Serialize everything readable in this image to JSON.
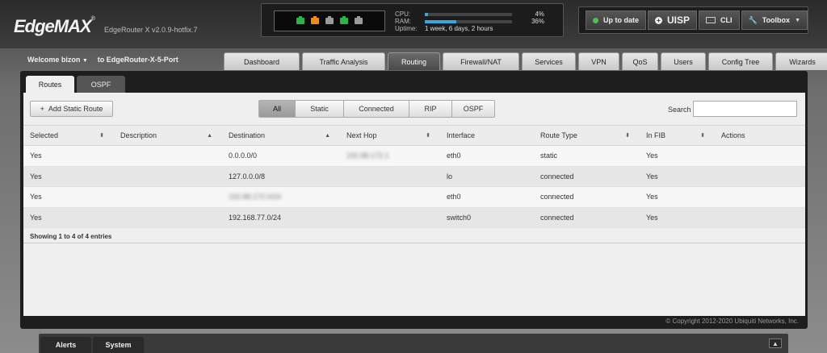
{
  "header": {
    "logo": "EdgeMAX",
    "logo_mark": "®",
    "model": "EdgeRouter X v2.0.9-hotfix.7",
    "ports": [
      {
        "color": "#2eb24a"
      },
      {
        "color": "#f08a1c"
      },
      {
        "color": "#9a9a9a"
      },
      {
        "color": "#2eb24a"
      },
      {
        "color": "#9a9a9a"
      }
    ],
    "cpu_label": "CPU:",
    "cpu_value": "4%",
    "cpu_percent": 4,
    "ram_label": "RAM:",
    "ram_value": "36%",
    "ram_percent": 36,
    "uptime_label": "Uptime:",
    "uptime_value": "1 week, 6 days, 2 hours",
    "update_status": "Up to date",
    "uisp_label": "UISP",
    "cli_label": "CLI",
    "toolbox_label": "Toolbox"
  },
  "welcome": {
    "user": "Welcome bizon",
    "device": "to EdgeRouter-X-5-Port"
  },
  "main_tabs": [
    {
      "label": "Dashboard",
      "w": 0
    },
    {
      "label": "Traffic Analysis"
    },
    {
      "label": "Routing",
      "active": true
    },
    {
      "label": "Firewall/NAT"
    },
    {
      "label": "Services"
    },
    {
      "label": "VPN"
    },
    {
      "label": "QoS"
    },
    {
      "label": "Users"
    },
    {
      "label": "Config Tree"
    },
    {
      "label": "Wizards"
    }
  ],
  "sub_tabs": [
    {
      "label": "Routes",
      "active": true
    },
    {
      "label": "OSPF"
    }
  ],
  "toolbar": {
    "add_route_label": "Add Static Route",
    "filters": [
      {
        "label": "All",
        "active": true
      },
      {
        "label": "Static"
      },
      {
        "label": "Connected"
      },
      {
        "label": "RIP"
      },
      {
        "label": "OSPF"
      }
    ],
    "search_label": "Search",
    "search_value": ""
  },
  "table": {
    "columns": [
      "Selected",
      "Description",
      "Destination",
      "Next Hop",
      "Interface",
      "Route Type",
      "In FIB",
      "Actions"
    ],
    "rows": [
      {
        "selected": "Yes",
        "description": "",
        "destination": "0.0.0.0/0",
        "next_hop": "192.88.172.1",
        "interface": "eth0",
        "route_type": "static",
        "in_fib": "Yes",
        "actions": ""
      },
      {
        "selected": "Yes",
        "description": "",
        "destination": "127.0.0.0/8",
        "next_hop": "",
        "interface": "lo",
        "route_type": "connected",
        "in_fib": "Yes",
        "actions": ""
      },
      {
        "selected": "Yes",
        "description": "",
        "destination": "192.88.172.0/24",
        "next_hop": "",
        "interface": "eth0",
        "route_type": "connected",
        "in_fib": "Yes",
        "actions": ""
      },
      {
        "selected": "Yes",
        "description": "",
        "destination": "192.168.77.0/24",
        "next_hop": "",
        "interface": "switch0",
        "route_type": "connected",
        "in_fib": "Yes",
        "actions": ""
      }
    ],
    "summary": "Showing 1 to 4 of 4 entries"
  },
  "copyright": "© Copyright 2012-2020 Ubiquiti Networks, Inc.",
  "bottom": {
    "alerts_label": "Alerts",
    "system_label": "System",
    "expand_symbol": "▲"
  }
}
